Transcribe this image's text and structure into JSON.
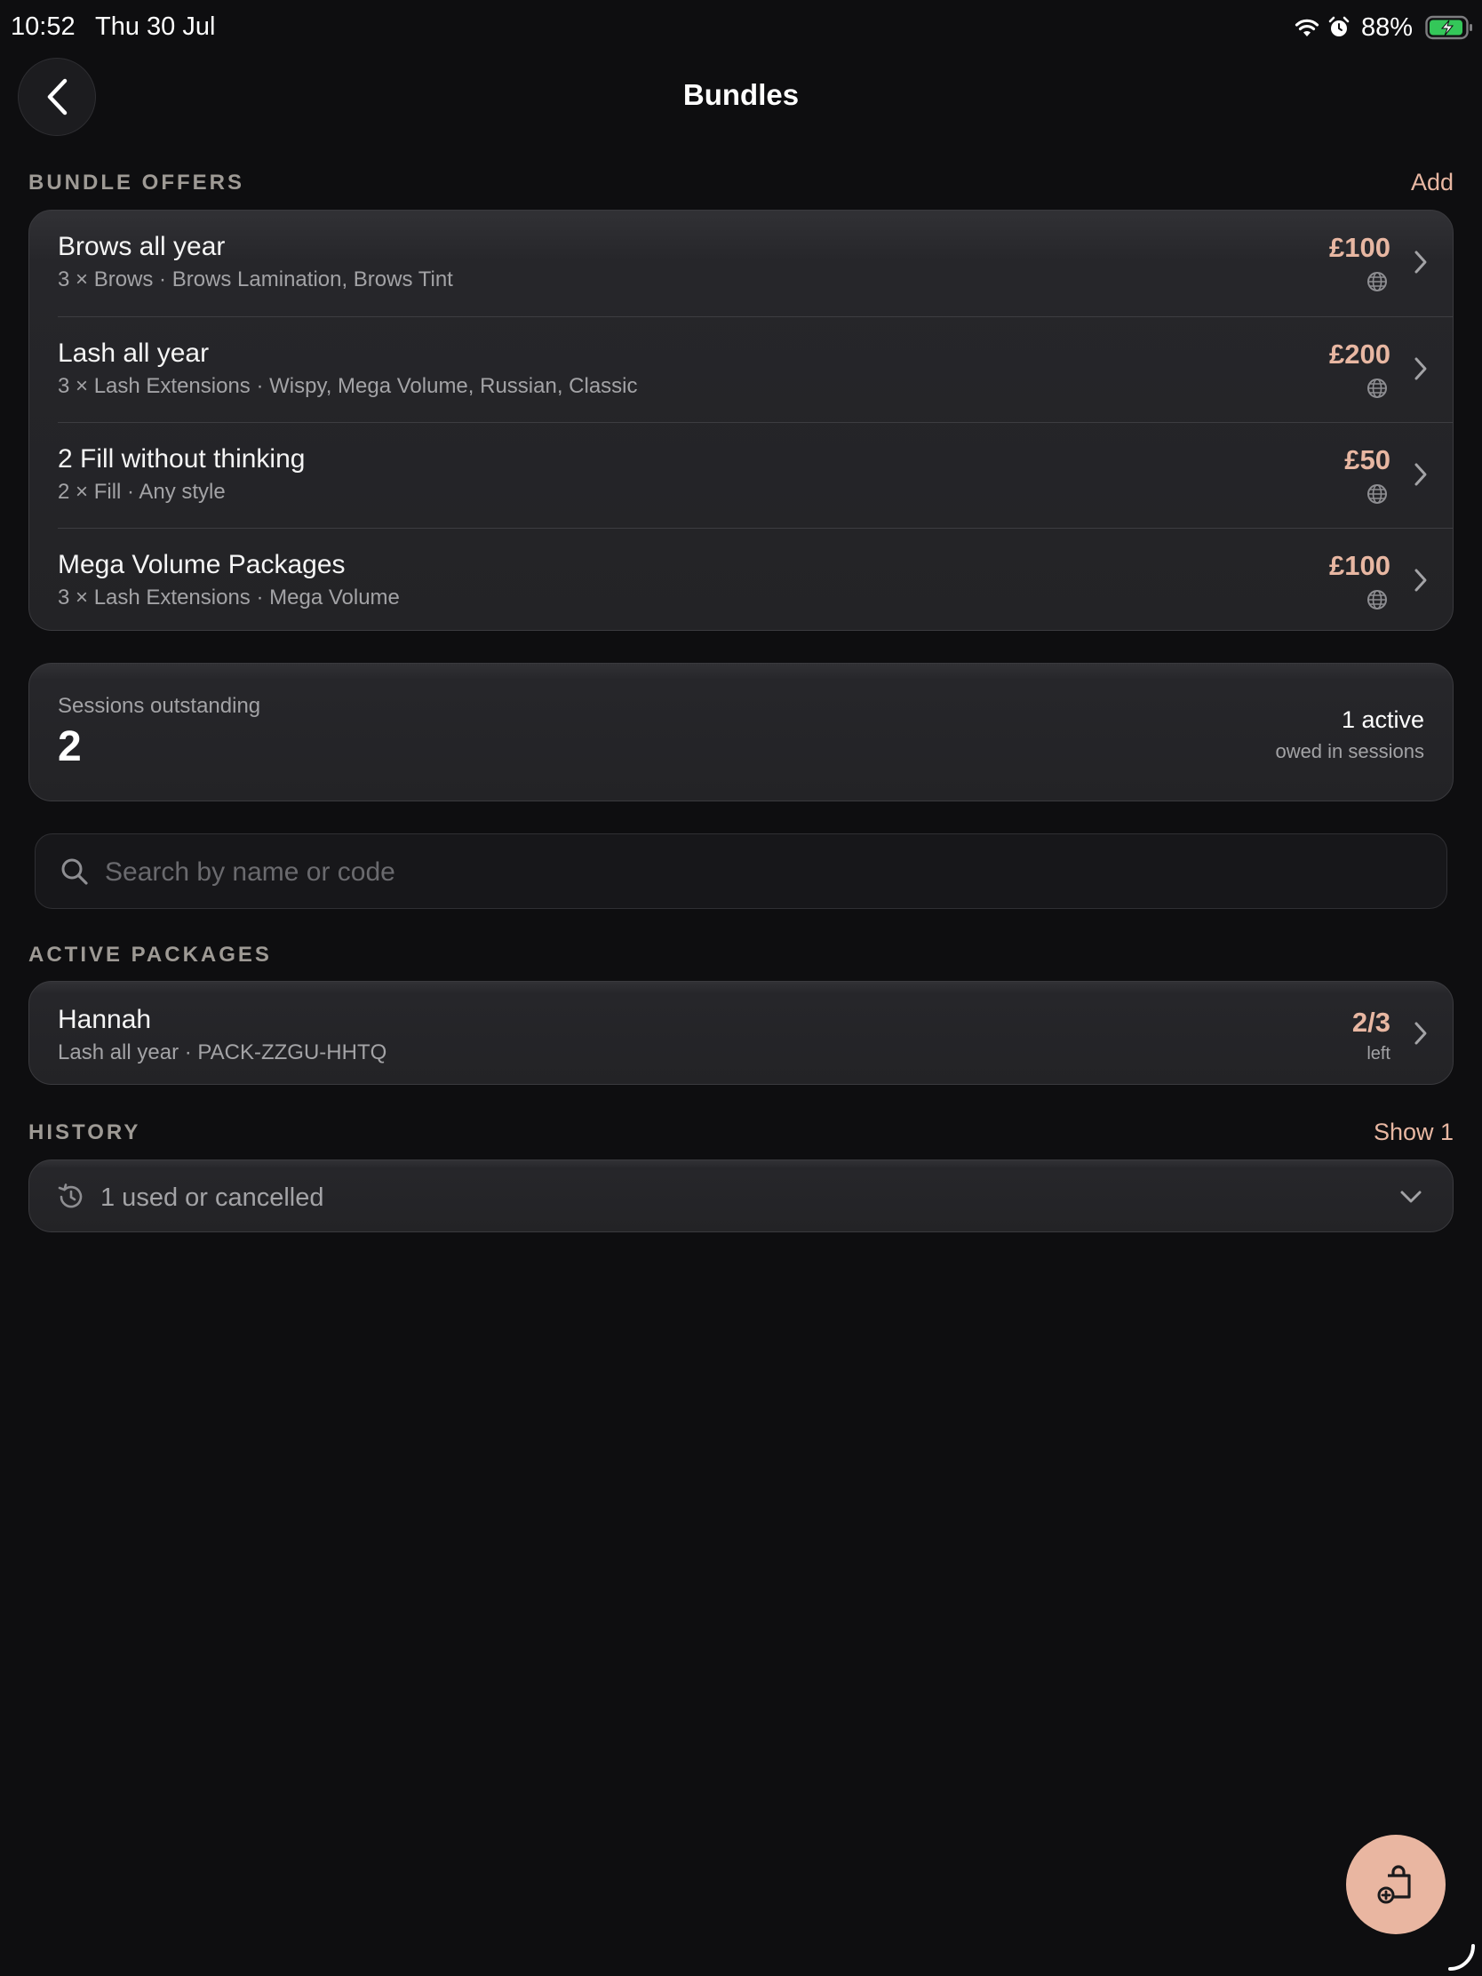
{
  "status_bar": {
    "time": "10:52",
    "date": "Thu 30 Jul",
    "battery_percent": "88%",
    "icons": [
      "wifi-icon",
      "alarm-icon",
      "battery-charging-icon"
    ]
  },
  "nav": {
    "back_icon": "chevron-left-icon",
    "title": "Bundles"
  },
  "bundle_offers": {
    "label": "BUNDLE OFFERS",
    "add_label": "Add",
    "items": [
      {
        "title": "Brows all year",
        "subtitle": "3 × Brows · Brows Lamination, Brows Tint",
        "price": "£100",
        "icon": "globe-icon"
      },
      {
        "title": "Lash all year",
        "subtitle": "3 × Lash Extensions · Wispy, Mega Volume, Russian, Classic",
        "price": "£200",
        "icon": "globe-icon"
      },
      {
        "title": "2 Fill without thinking",
        "subtitle": "2 × Fill · Any style",
        "price": "£50",
        "icon": "globe-icon"
      },
      {
        "title": "Mega Volume Packages",
        "subtitle": "3 × Lash Extensions · Mega Volume",
        "price": "£100",
        "icon": "globe-icon"
      }
    ]
  },
  "sessions": {
    "label": "Sessions outstanding",
    "value": "2",
    "active": "1 active",
    "active_sub": "owed in sessions"
  },
  "search": {
    "placeholder": "Search by name or code",
    "value": ""
  },
  "active_packages": {
    "label": "ACTIVE PACKAGES",
    "items": [
      {
        "name": "Hannah",
        "subtitle": "Lash all year · PACK-ZZGU-HHTQ",
        "count": "2/3",
        "count_label": "left"
      }
    ]
  },
  "history": {
    "label": "HISTORY",
    "action_label": "Show 1",
    "summary": "1 used or cancelled"
  },
  "fab": {
    "icon": "bag-add-icon"
  },
  "colors": {
    "background": "#0e0e10",
    "accent": "#e8b7a2",
    "fab": "#e9b6a1",
    "battery": "#34c759"
  }
}
